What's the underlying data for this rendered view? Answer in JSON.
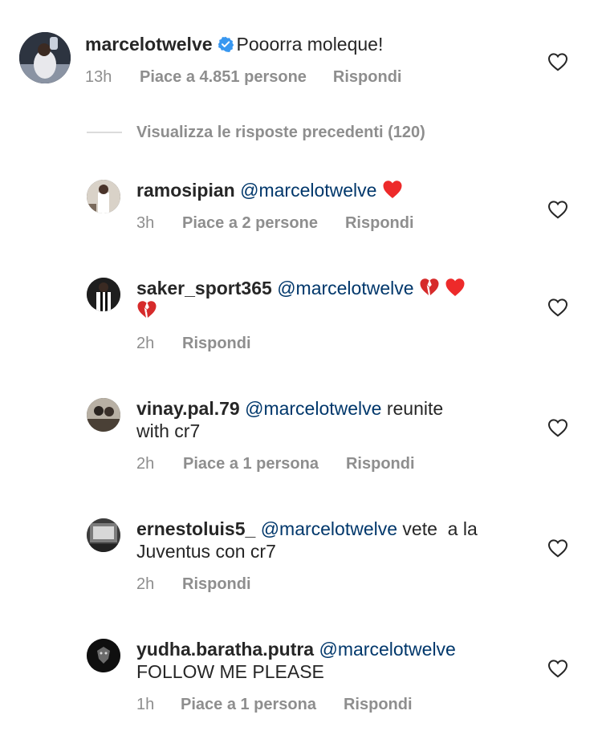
{
  "main_comment": {
    "username": "marcelotwelve",
    "text": "Pooorra moleque!",
    "time": "13h",
    "likes": "Piace a 4.851 persone",
    "reply": "Rispondi"
  },
  "view_replies": "Visualizza le risposte precedenti (120)",
  "replies": [
    {
      "username": "ramosipian",
      "mention": "@marcelotwelve",
      "text": "",
      "time": "3h",
      "likes": "Piace a 2 persone",
      "reply": "Rispondi"
    },
    {
      "username": "saker_sport365",
      "mention": "@marcelotwelve",
      "text": "",
      "time": "2h",
      "likes": "",
      "reply": "Rispondi"
    },
    {
      "username": "vinay.pal.79",
      "mention": "@marcelotwelve",
      "text": "reunite",
      "text2": "with cr7",
      "time": "2h",
      "likes": "Piace a 1 persona",
      "reply": "Rispondi"
    },
    {
      "username": "ernestoluis5_",
      "mention": "@marcelotwelve",
      "text": "vete  a la",
      "text2": "Juventus con cr7",
      "time": "2h",
      "likes": "",
      "reply": "Rispondi"
    },
    {
      "username": "yudha.baratha.putra",
      "mention": "@marcelotwelve",
      "text": "",
      "text2": "FOLLOW ME PLEASE",
      "time": "1h",
      "likes": "Piace a 1 persona",
      "reply": "Rispondi"
    }
  ],
  "icons": {
    "like": "heart-outline-icon",
    "verified": "verified-badge-icon",
    "red_heart": "red-heart-emoji",
    "broken_heart": "broken-heart-emoji"
  },
  "colors": {
    "text": "#262626",
    "secondary": "#8e8e8e",
    "mention": "#00376b",
    "verified": "#3897f0",
    "heart": "#ed4956"
  }
}
